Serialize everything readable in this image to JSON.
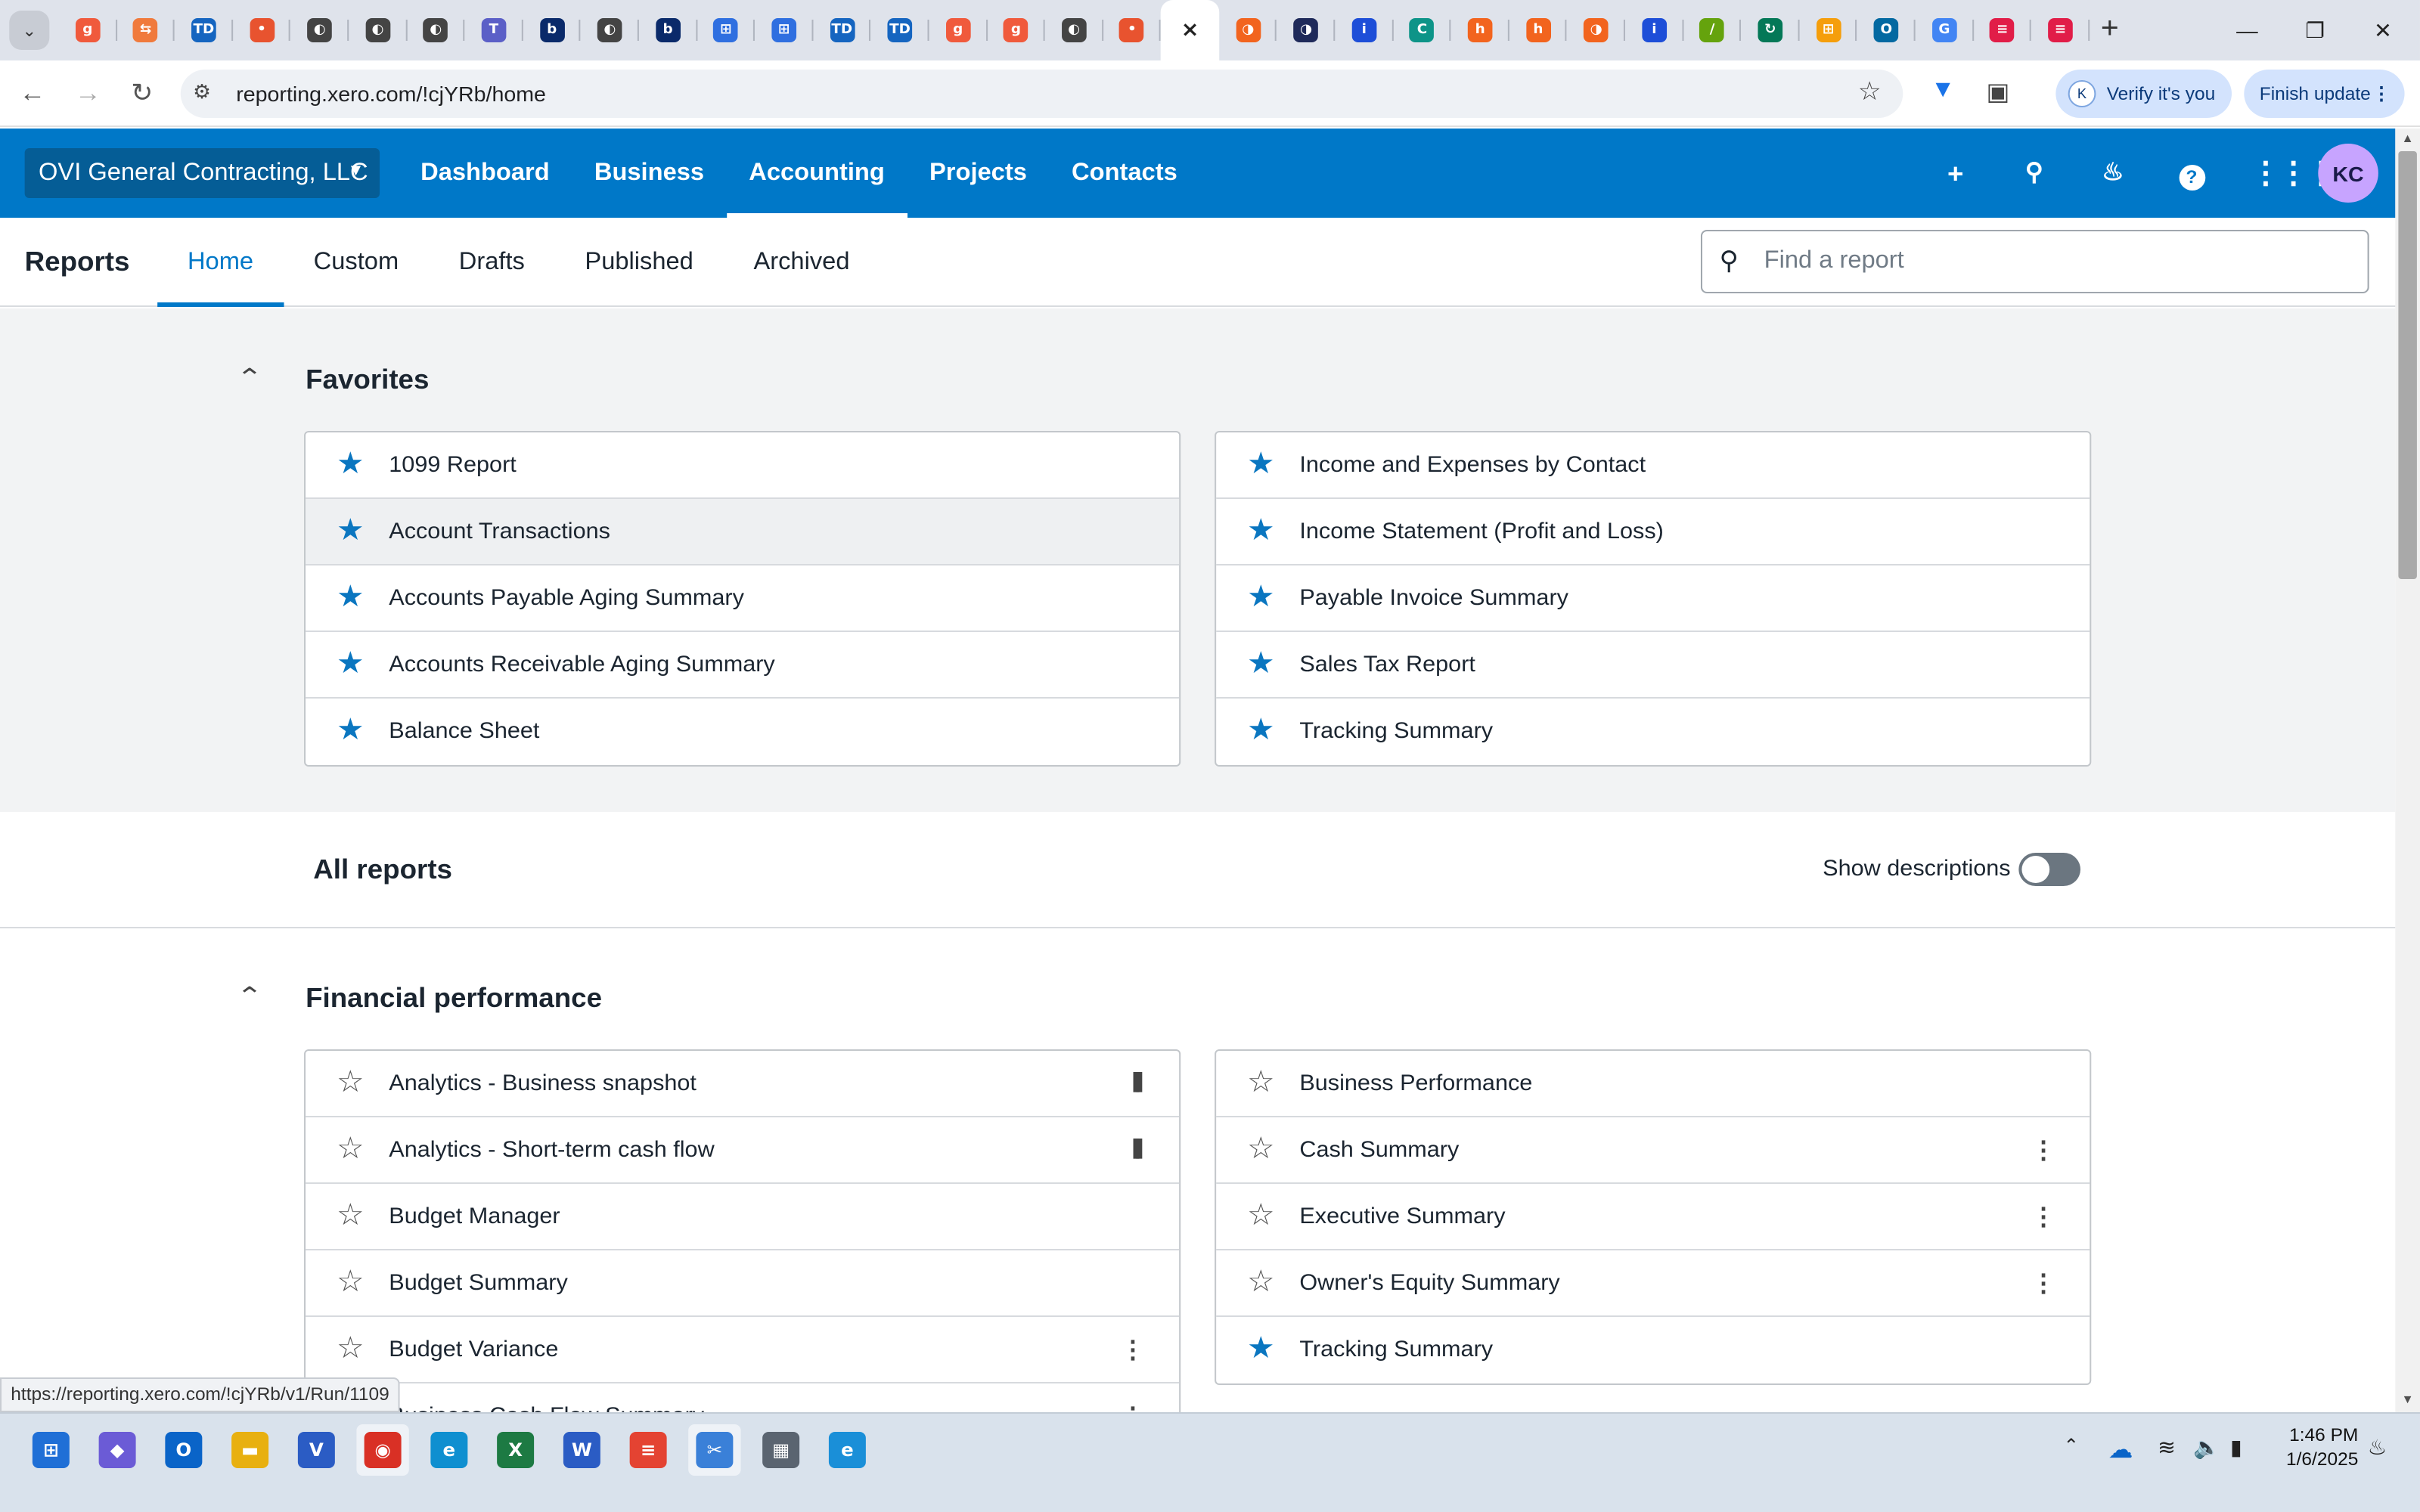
{
  "browser": {
    "url": "reporting.xero.com/!cjYRb/home",
    "verify_label": "Verify it's you",
    "verify_avatar": "K",
    "finish_label": "Finish update",
    "status_url": "https://reporting.xero.com/!cjYRb/v1/Run/1109",
    "tabs": [
      {
        "icon": "g",
        "color": "#f05a3c"
      },
      {
        "icon": "⇆",
        "color": "#f07a3c"
      },
      {
        "icon": "TD",
        "color": "#1565c0"
      },
      {
        "icon": "•",
        "color": "#e8532f"
      },
      {
        "icon": "◐",
        "color": "#444"
      },
      {
        "icon": "◐",
        "color": "#444"
      },
      {
        "icon": "◐",
        "color": "#444"
      },
      {
        "icon": "T",
        "color": "#5b5fc7"
      },
      {
        "icon": "b",
        "color": "#0a2a6a"
      },
      {
        "icon": "◐",
        "color": "#444"
      },
      {
        "icon": "b",
        "color": "#0a2a6a"
      },
      {
        "icon": "⊞",
        "color": "#2f6fe0"
      },
      {
        "icon": "⊞",
        "color": "#2f6fe0"
      },
      {
        "icon": "TD",
        "color": "#1565c0"
      },
      {
        "icon": "TD",
        "color": "#1565c0"
      },
      {
        "icon": "g",
        "color": "#f05a3c"
      },
      {
        "icon": "g",
        "color": "#f05a3c"
      },
      {
        "icon": "◐",
        "color": "#444"
      },
      {
        "icon": "•",
        "color": "#e8532f"
      },
      {
        "icon": "×",
        "color": "#222"
      },
      {
        "icon": "◑",
        "color": "#f2641e"
      },
      {
        "icon": "◑",
        "color": "#1f2a5a"
      },
      {
        "icon": "i",
        "color": "#1d4ed8"
      },
      {
        "icon": "C",
        "color": "#0d9488"
      },
      {
        "icon": "h",
        "color": "#f2641e"
      },
      {
        "icon": "h",
        "color": "#f2641e"
      },
      {
        "icon": "◑",
        "color": "#f2641e"
      },
      {
        "icon": "i",
        "color": "#1d4ed8"
      },
      {
        "icon": "/",
        "color": "#65a30d"
      },
      {
        "icon": "↻",
        "color": "#047857"
      },
      {
        "icon": "⊞",
        "color": "#f59e0b"
      },
      {
        "icon": "O",
        "color": "#0369a1"
      },
      {
        "icon": "G",
        "color": "#4285f4"
      },
      {
        "icon": "≡",
        "color": "#e11d48"
      },
      {
        "icon": "≡",
        "color": "#e11d48"
      }
    ]
  },
  "xero": {
    "org_name": "OVI General Contracting, LLC",
    "nav": [
      "Dashboard",
      "Business",
      "Accounting",
      "Projects",
      "Contacts"
    ],
    "selected_nav": "Accounting",
    "avatar_initials": "KC",
    "accent_color": "#0078c8"
  },
  "reports": {
    "title": "Reports",
    "tabs": [
      "Home",
      "Custom",
      "Drafts",
      "Published",
      "Archived"
    ],
    "selected_tab": "Home",
    "search_placeholder": "Find a report",
    "favorites_title": "Favorites",
    "favorites_left": [
      "1099 Report",
      "Account Transactions",
      "Accounts Payable Aging Summary",
      "Accounts Receivable Aging Summary",
      "Balance Sheet"
    ],
    "favorites_right": [
      "Income and Expenses by Contact",
      "Income Statement (Profit and Loss)",
      "Payable Invoice Summary",
      "Sales Tax Report",
      "Tracking Summary"
    ],
    "all_reports_title": "All reports",
    "show_descriptions_label": "Show descriptions",
    "show_descriptions_on": false,
    "financial_title": "Financial performance",
    "financial_left": [
      {
        "label": "Analytics - Business snapshot",
        "starred": false,
        "action": "analytics"
      },
      {
        "label": "Analytics - Short-term cash flow",
        "starred": false,
        "action": "analytics"
      },
      {
        "label": "Budget Manager",
        "starred": false,
        "action": ""
      },
      {
        "label": "Budget Summary",
        "starred": false,
        "action": ""
      },
      {
        "label": "Budget Variance",
        "starred": false,
        "action": "more"
      },
      {
        "label": "Business Cash Flow Summary",
        "starred": false,
        "action": "more"
      }
    ],
    "financial_right": [
      {
        "label": "Business Performance",
        "starred": false,
        "action": ""
      },
      {
        "label": "Cash Summary",
        "starred": false,
        "action": "more"
      },
      {
        "label": "Executive Summary",
        "starred": false,
        "action": "more"
      },
      {
        "label": "Owner's Equity Summary",
        "starred": false,
        "action": "more"
      },
      {
        "label": "Tracking Summary",
        "starred": true,
        "action": ""
      }
    ]
  },
  "taskbar": {
    "apps": [
      {
        "name": "windows-start",
        "icon": "⊞",
        "color": "#1f6fd6"
      },
      {
        "name": "copilot",
        "icon": "◆",
        "color": "#6b5bd6"
      },
      {
        "name": "outlook",
        "icon": "O",
        "color": "#0a64c8"
      },
      {
        "name": "file-explorer",
        "icon": "▬",
        "color": "#e8b010"
      },
      {
        "name": "visio",
        "icon": "V",
        "color": "#2b5cc4"
      },
      {
        "name": "chrome",
        "icon": "◉",
        "color": "#d93025"
      },
      {
        "name": "edge",
        "icon": "e",
        "color": "#0f8fd0"
      },
      {
        "name": "excel",
        "icon": "X",
        "color": "#1d7a43"
      },
      {
        "name": "word",
        "icon": "W",
        "color": "#2b5cc4"
      },
      {
        "name": "todoist",
        "icon": "≡",
        "color": "#e44332"
      },
      {
        "name": "snipping-tool",
        "icon": "✂",
        "color": "#3a80d8"
      },
      {
        "name": "calculator",
        "icon": "▦",
        "color": "#5a6470"
      },
      {
        "name": "edge-dev",
        "icon": "e",
        "color": "#1a8fd8"
      }
    ],
    "time": "1:46 PM",
    "date": "1/6/2025"
  }
}
